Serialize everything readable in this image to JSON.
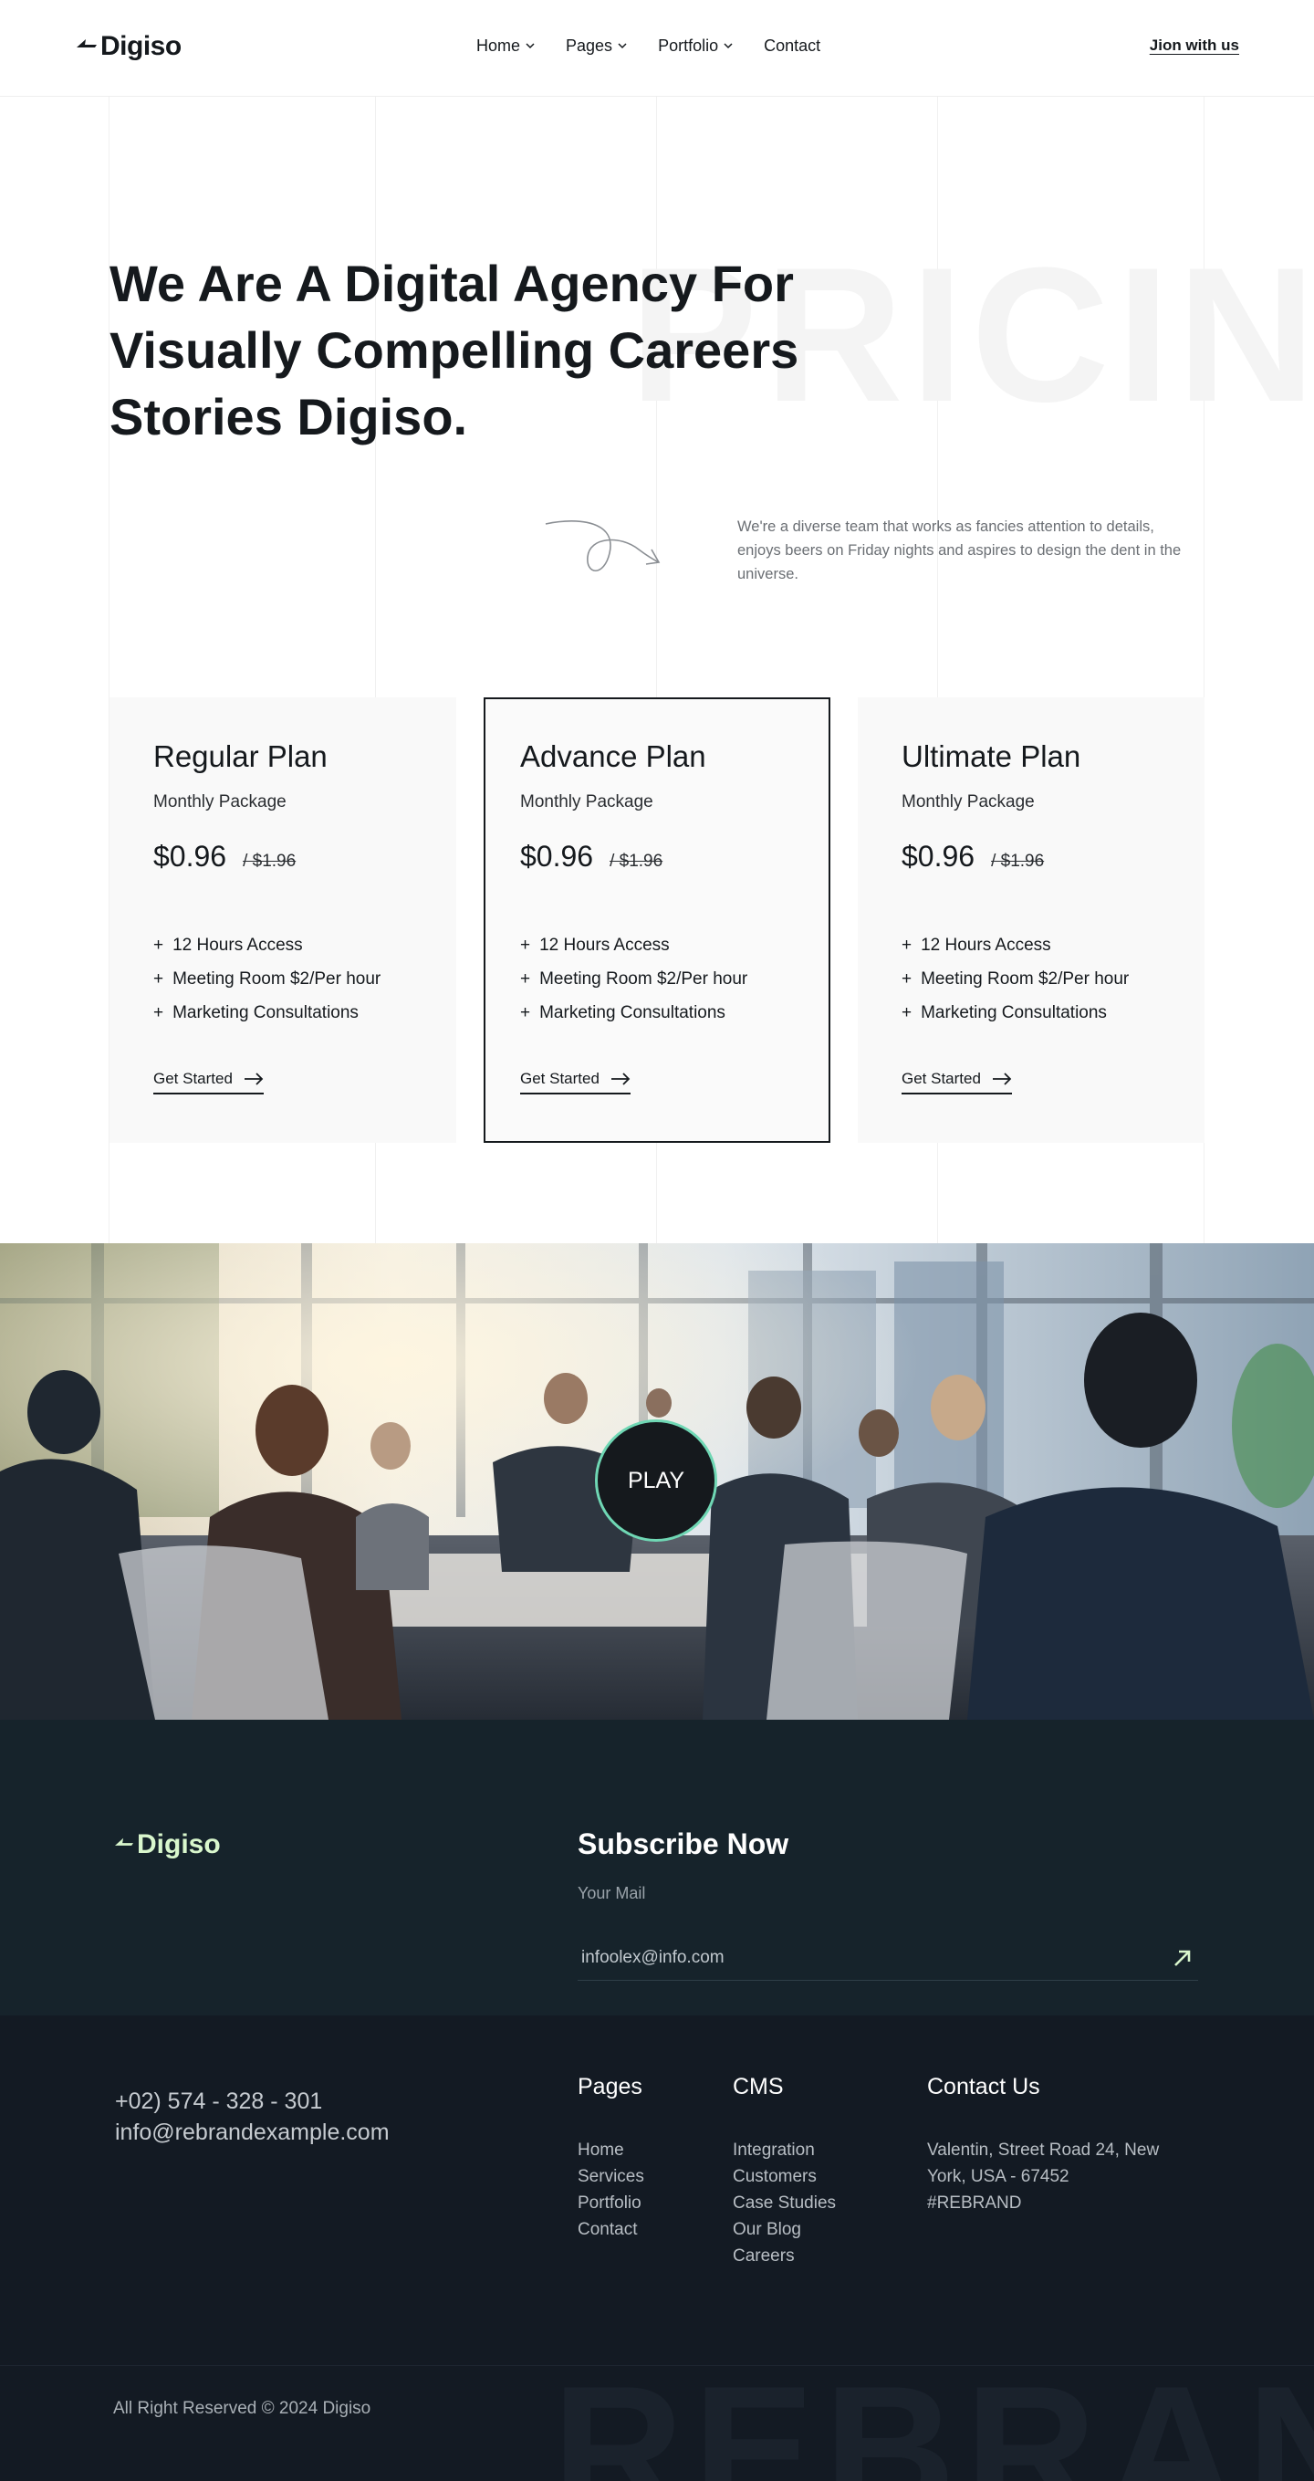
{
  "nav": {
    "logo": "Digiso",
    "items": [
      {
        "label": "Home"
      },
      {
        "label": "Pages"
      },
      {
        "label": "Portfolio"
      },
      {
        "label": "Contact"
      }
    ],
    "cta": "Jion with us"
  },
  "hero": {
    "watermark": "PRICIN",
    "title": "We Are A Digital Agency For Visually Compelling Careers Stories Digiso.",
    "description": "We're a diverse team that works as fancies attention to details, enjoys beers on Friday nights and aspires to design the dent in the universe."
  },
  "plans": [
    {
      "name": "Regular Plan",
      "subtitle": "Monthly Package",
      "price": "$0.96",
      "old_price": "/ $1.96",
      "features": [
        "12 Hours Access",
        "Meeting Room $2/Per hour",
        "Marketing Consultations"
      ],
      "cta": "Get Started"
    },
    {
      "name": "Advance Plan",
      "subtitle": "Monthly Package",
      "price": "$0.96",
      "old_price": "/ $1.96",
      "features": [
        "12 Hours Access",
        "Meeting Room $2/Per hour",
        "Marketing Consultations"
      ],
      "cta": "Get Started"
    },
    {
      "name": "Ultimate Plan",
      "subtitle": "Monthly Package",
      "price": "$0.96",
      "old_price": "/ $1.96",
      "features": [
        "12 Hours Access",
        "Meeting Room $2/Per hour",
        "Marketing Consultations"
      ],
      "cta": "Get Started"
    }
  ],
  "video": {
    "play_label": "PLAY"
  },
  "subscribe": {
    "logo": "Digiso",
    "title": "Subscribe Now",
    "label": "Your Mail",
    "placeholder": "infoolex@info.com"
  },
  "footer": {
    "phone": "+02) 574 - 328 - 301",
    "email": "info@rebrandexample.com",
    "pages": {
      "title": "Pages",
      "links": [
        "Home",
        "Services",
        "Portfolio",
        "Contact"
      ]
    },
    "cms": {
      "title": "CMS",
      "links": [
        "Integration",
        "Customers",
        "Case Studies",
        "Our Blog",
        "Careers"
      ]
    },
    "contact": {
      "title": "Contact Us",
      "address": "Valentin, Street Road 24, New York, USA - 67452",
      "tag": "#REBRAND"
    },
    "watermark": "REBRAND",
    "copyright": "All Right Reserved © 2024 Digiso"
  },
  "colors": {
    "dark": "#15191d",
    "subscribe_bg": "#16232b",
    "footer_bg": "#131a23",
    "accent_green": "#d9f7cd",
    "play_ring": "#6fd7b4"
  }
}
